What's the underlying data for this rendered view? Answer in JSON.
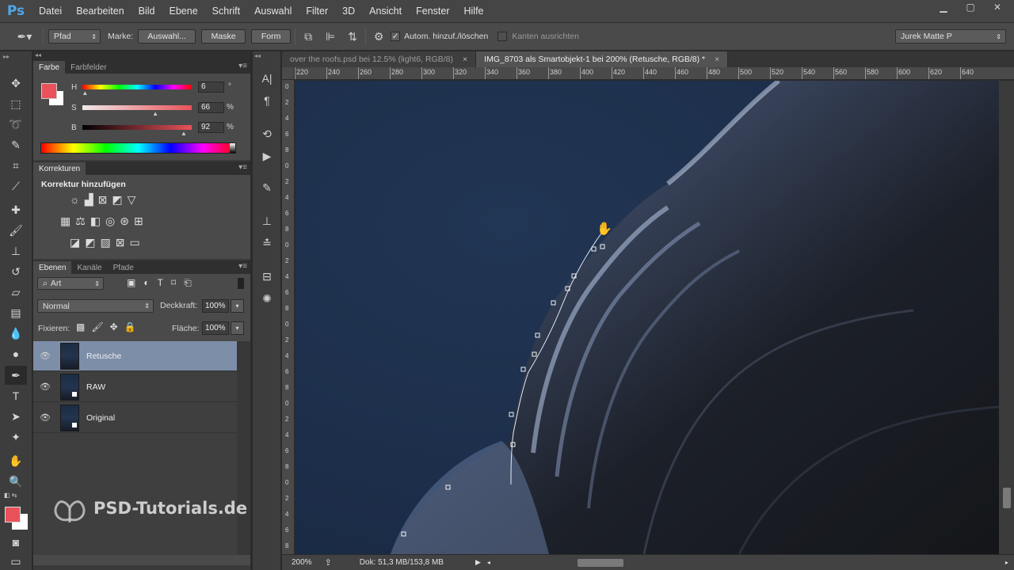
{
  "app": {
    "logo": "Ps"
  },
  "menu": [
    "Datei",
    "Bearbeiten",
    "Bild",
    "Ebene",
    "Schrift",
    "Auswahl",
    "Filter",
    "3D",
    "Ansicht",
    "Fenster",
    "Hilfe"
  ],
  "options": {
    "mode": "Pfad",
    "marke_label": "Marke:",
    "auswahl_btn": "Auswahl...",
    "maske_btn": "Maske",
    "form_btn": "Form",
    "auto_label": "Autom. hinzuf./löschen",
    "kanten_label": "Kanten ausrichten",
    "workspace": "Jurek Matte P"
  },
  "color_panel": {
    "tabs": [
      "Farbe",
      "Farbfelder"
    ],
    "h_label": "H",
    "h_value": "6",
    "h_unit": "°",
    "h_level": 0.017,
    "s_label": "S",
    "s_value": "66",
    "s_unit": "%",
    "s_level": 0.66,
    "b_label": "B",
    "b_value": "92",
    "b_unit": "%",
    "b_level": 0.92,
    "foreground": "#e9525a",
    "background": "#ffffff"
  },
  "adjustments": {
    "tab": "Korrekturen",
    "title": "Korrektur hinzufügen"
  },
  "layers_panel": {
    "tabs": [
      "Ebenen",
      "Kanäle",
      "Pfade"
    ],
    "filter": "Art",
    "blend_mode": "Normal",
    "opacity_label": "Deckkraft:",
    "opacity_value": "100%",
    "lock_label": "Fixieren:",
    "fill_label": "Fläche:",
    "fill_value": "100%",
    "layers": [
      {
        "name": "Retusche",
        "selected": true
      },
      {
        "name": "RAW",
        "selected": false
      },
      {
        "name": "Original",
        "selected": false
      }
    ]
  },
  "documents": {
    "tabs": [
      {
        "label": "over the roofs.psd bei 12.5% (light6, RGB/8)",
        "close": "×"
      },
      {
        "label": "IMG_8703 als Smartobjekt-1 bei 200% (Retusche, RGB/8) *",
        "close": "×"
      }
    ],
    "ruler_top": [
      "220",
      "240",
      "260",
      "280",
      "300",
      "320",
      "340",
      "360",
      "380",
      "400",
      "420",
      "440",
      "460",
      "480",
      "500",
      "520",
      "540",
      "560",
      "580",
      "600",
      "620",
      "640"
    ],
    "ruler_left": [
      "0",
      "2",
      "4",
      "6",
      "8",
      "0",
      "2",
      "4",
      "6",
      "8",
      "0",
      "2",
      "4",
      "6",
      "8",
      "0",
      "2",
      "4",
      "6",
      "8",
      "0",
      "2",
      "4",
      "6",
      "8",
      "0",
      "2",
      "4",
      "6",
      "8"
    ]
  },
  "status": {
    "zoom": "200%",
    "doc_info": "Dok: 51,3 MB/153,8 MB"
  },
  "watermark": {
    "text": "PSD-Tutorials.de"
  }
}
